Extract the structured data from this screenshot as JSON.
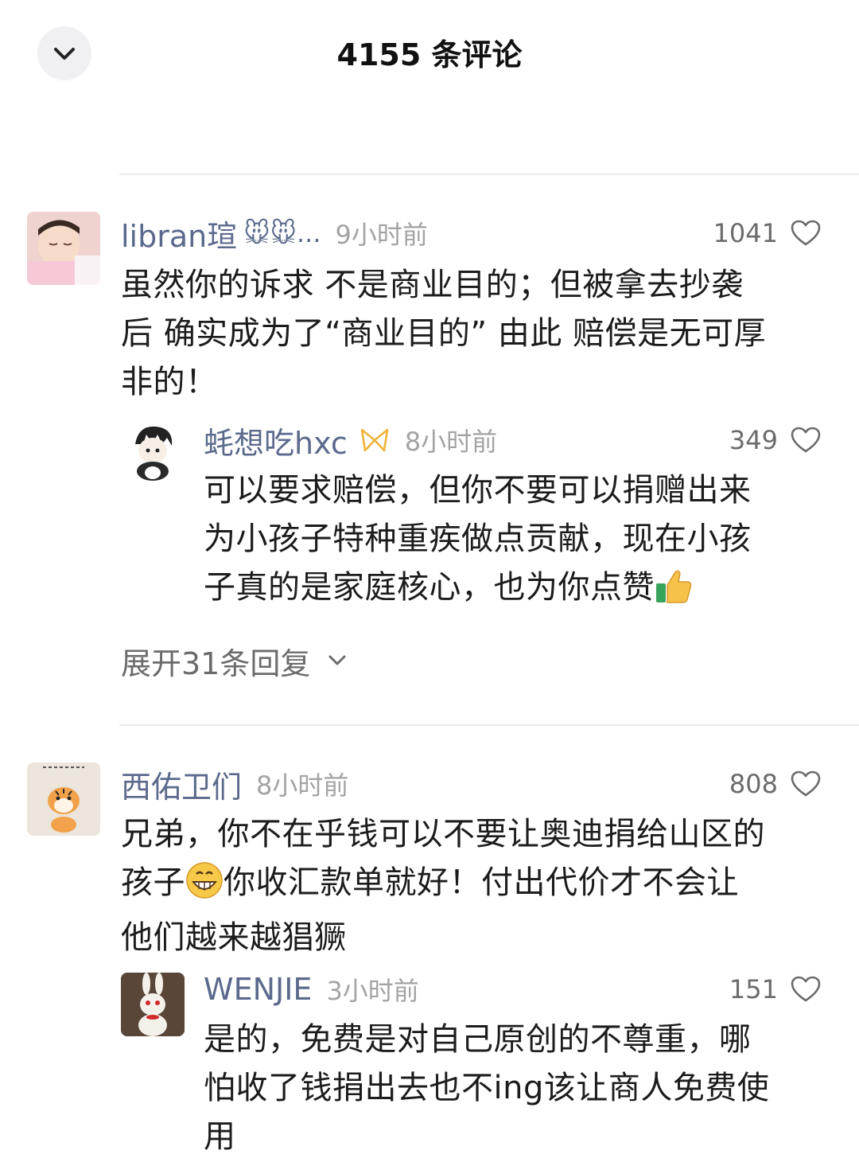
{
  "header": {
    "title": "4155 条评论",
    "close_icon": "chevron-down-icon"
  },
  "comments": [
    {
      "username": "libran瑄",
      "badges": "🐭🐭...",
      "time": "9小时前",
      "likes": "1041",
      "lines": [
        "虽然你的诉求 不是商业目的；但被拿去抄袭",
        "后 确实成为了“商业目的” 由此 赔偿是无可厚",
        "非的！"
      ],
      "reply": {
        "username": "蚝想吃hxc",
        "time": "8小时前",
        "likes": "349",
        "lines": [
          "可以要求赔偿，但你不要可以捐赠出来",
          "为小孩子特种重疾做点贡献，现在小孩",
          "子真的是家庭核心，也为你点赞"
        ]
      },
      "expand_label": "展开31条回复"
    },
    {
      "username": "西佑卫们",
      "time": "8小时前",
      "likes": "808",
      "line1": "兄弟，你不在乎钱可以不要让奥迪捐给山区的",
      "line2a": "孩子",
      "line2b": "你收汇款单就好！付出代价才不会让",
      "line3": "他们越来越猖獗",
      "reply": {
        "username": "WENJIE",
        "time": "3小时前",
        "likes": "151",
        "lines": [
          "是的，免费是对自己原创的不尊重，哪",
          "怕收了钱捐出去也不ing该让商人免费使",
          "用"
        ]
      }
    }
  ],
  "colors": {
    "username": "#5b6a8c",
    "time": "#a3a3a3",
    "divider": "#ececec"
  }
}
